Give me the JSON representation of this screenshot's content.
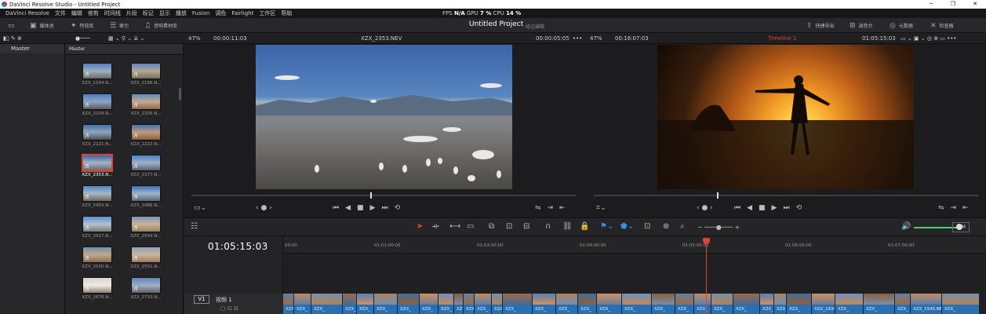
{
  "window": {
    "title": "DaVinci Resolve Studio - Untitled Project",
    "buttons": [
      "─",
      "❐",
      "✕"
    ]
  },
  "menu": [
    "DaVinci Resolve",
    "文件",
    "编辑",
    "修剪",
    "时间线",
    "片段",
    "标记",
    "显示",
    "播放",
    "Fusion",
    "调色",
    "Fairlight",
    "工作区",
    "帮助"
  ],
  "perf": {
    "fps_label": "FPS",
    "fps_value": "N/A",
    "gpu_label": "GPU",
    "gpu_value": "7 %",
    "cpu_label": "CPU",
    "cpu_value": "14 %"
  },
  "toolbar": {
    "media_pool": "媒体池",
    "effects": "特效库",
    "index": "索引",
    "sound_library": "音响素材库",
    "project_title": "Untitled Project",
    "edited": "经过编辑",
    "quick_export": "快捷导出",
    "mixer": "调音台",
    "metadata": "元数据",
    "inspector": "检查器"
  },
  "source_viewer": {
    "zoom": "47%",
    "duration": "00:00:11:03",
    "clip_name": "XZX_2353.NEV",
    "timecode": "00:00:05:05"
  },
  "program_viewer": {
    "zoom": "47%",
    "duration": "00:16:07:03",
    "timeline_name": "Timeline 1",
    "timecode": "01:05:15:03"
  },
  "bin": {
    "root": "Master",
    "header": "Master"
  },
  "clips": [
    {
      "name": "XZX_2164.N...",
      "colors": [
        "#4f7fbf",
        "#9fb0c0",
        "#6b6a66"
      ]
    },
    {
      "name": "XZX_2196.N...",
      "colors": [
        "#5e88c2",
        "#b2a990",
        "#7a6f60"
      ]
    },
    {
      "name": "XZX_2204.N...",
      "colors": [
        "#4b7ec2",
        "#8ea4c0",
        "#5a5c60"
      ]
    },
    {
      "name": "XZX_2205.N...",
      "colors": [
        "#5d8ac0",
        "#c7a98c",
        "#8a6a50"
      ]
    },
    {
      "name": "XZX_2221.N...",
      "colors": [
        "#3d6fae",
        "#8fa7bd",
        "#4d4d52"
      ]
    },
    {
      "name": "XZX_2222.N...",
      "colors": [
        "#3f73b5",
        "#c09a7c",
        "#8a5f40"
      ]
    },
    {
      "name": "XZX_2353.N...",
      "colors": [
        "#3a64a8",
        "#a2b4c2",
        "#6a6864"
      ],
      "selected": true
    },
    {
      "name": "XZX_2377.N...",
      "colors": [
        "#4a7fc8",
        "#9cb2c8",
        "#5b6068"
      ]
    },
    {
      "name": "XZX_2403.N...",
      "colors": [
        "#4f86c8",
        "#a8b8c4",
        "#6e6860"
      ]
    },
    {
      "name": "XZX_2486.N...",
      "colors": [
        "#3b6db8",
        "#9fb6c8",
        "#606672"
      ]
    },
    {
      "name": "XZX_2527.N...",
      "colors": [
        "#5a90d0",
        "#b0c2cf",
        "#7c7a76"
      ]
    },
    {
      "name": "XZX_2549.N...",
      "colors": [
        "#7a96b8",
        "#c8b49a",
        "#9a8060"
      ]
    },
    {
      "name": "XZX_2550.N...",
      "colors": [
        "#6f8fb0",
        "#c4a68c",
        "#8a6c52"
      ]
    },
    {
      "name": "XZX_2551.N...",
      "colors": [
        "#8aa4c0",
        "#d0b49a",
        "#9a7a60"
      ]
    },
    {
      "name": "XZX_2678.N...",
      "colors": [
        "#d8d4cc",
        "#f0ece4",
        "#8a8070"
      ]
    },
    {
      "name": "XZX_2733.N...",
      "colors": [
        "#5a84b8",
        "#a0b0c0",
        "#62626a"
      ]
    }
  ],
  "timeline": {
    "timecode": "01:05:15:03",
    "ruler": [
      "00:00",
      "01:02:00:00",
      "01:03:00:00",
      "01:04:00:00",
      "01:05:00:00",
      "01:06:00:00",
      "01:07:00:00"
    ],
    "track": {
      "id": "V1",
      "name": "视频 1"
    },
    "audio_toggle": "DIM",
    "clip_labels": [
      "XZX_1934.NEV",
      "XZX_1936.NEV"
    ]
  },
  "accent": "#e0433a"
}
